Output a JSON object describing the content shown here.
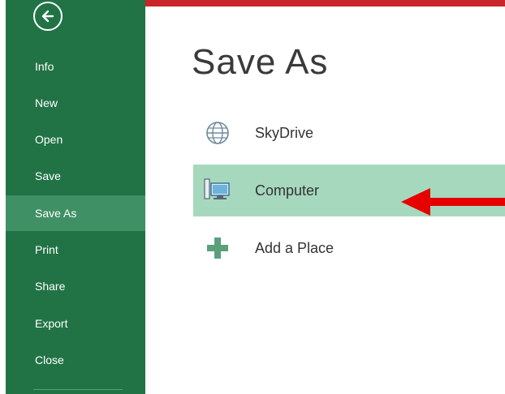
{
  "sidebar": {
    "items": [
      {
        "label": "Info"
      },
      {
        "label": "New"
      },
      {
        "label": "Open"
      },
      {
        "label": "Save"
      },
      {
        "label": "Save As",
        "selected": true
      },
      {
        "label": "Print"
      },
      {
        "label": "Share"
      },
      {
        "label": "Export"
      },
      {
        "label": "Close"
      }
    ]
  },
  "main": {
    "title": "Save As",
    "places": [
      {
        "label": "SkyDrive",
        "icon": "globe-icon"
      },
      {
        "label": "Computer",
        "icon": "computer-icon",
        "selected": true
      },
      {
        "label": "Add a Place",
        "icon": "plus-icon"
      }
    ]
  },
  "colors": {
    "sidebar": "#217346",
    "sidebar_selected": "#3f9065",
    "row_selected": "#a6d8be",
    "accent_bar": "#c8262a",
    "arrow": "#e60000"
  }
}
